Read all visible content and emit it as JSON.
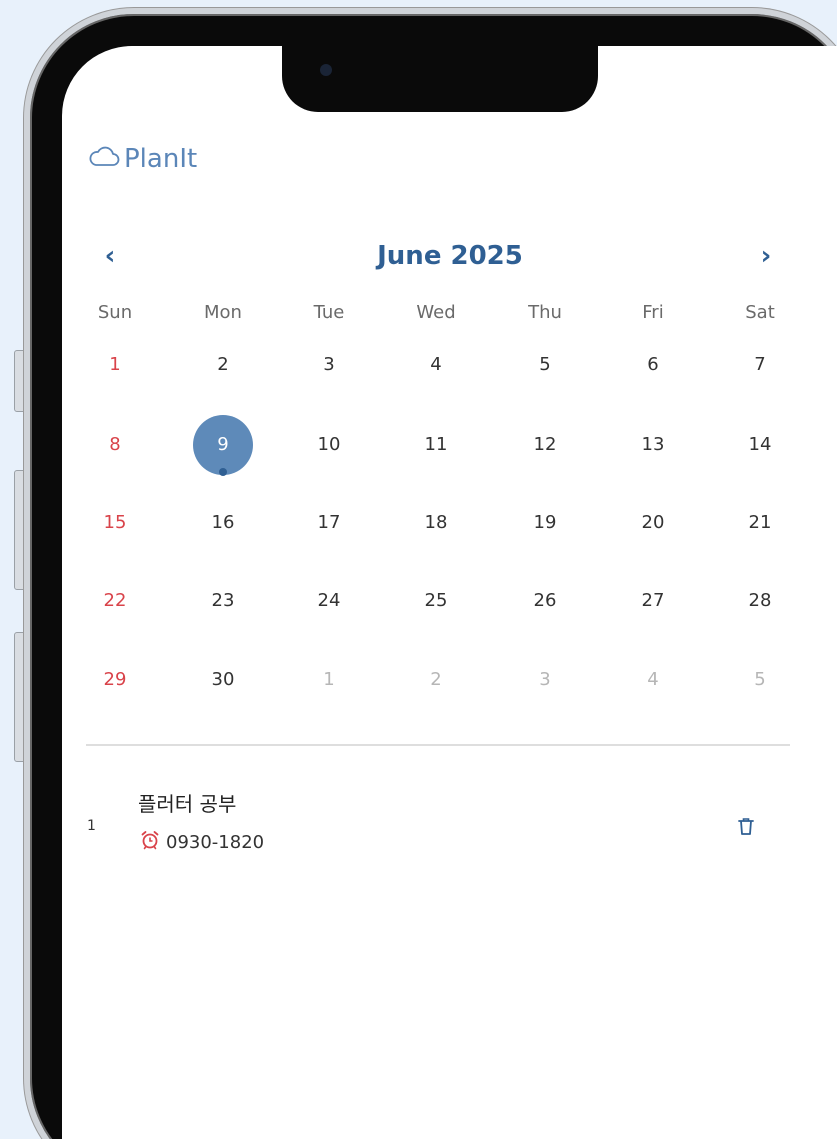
{
  "app": {
    "name": "PlanIt",
    "logo_icon": "cloud-icon",
    "accent_color": "#2f5f93",
    "selected_color": "#5e8ab9",
    "sunday_color": "#d9434a"
  },
  "calendar": {
    "month_title": "June 2025",
    "prev_icon": "chevron-left-icon",
    "next_icon": "chevron-right-icon",
    "prev_label": "‹",
    "next_label": "›",
    "weekdays": [
      "Sun",
      "Mon",
      "Tue",
      "Wed",
      "Thu",
      "Fri",
      "Sat"
    ],
    "selected_day": "9",
    "weeks": [
      [
        {
          "d": "1",
          "t": "sun"
        },
        {
          "d": "2",
          "t": "cur"
        },
        {
          "d": "3",
          "t": "cur"
        },
        {
          "d": "4",
          "t": "cur"
        },
        {
          "d": "5",
          "t": "cur"
        },
        {
          "d": "6",
          "t": "cur"
        },
        {
          "d": "7",
          "t": "cur"
        }
      ],
      [
        {
          "d": "8",
          "t": "sun"
        },
        {
          "d": "9",
          "t": "sel",
          "dot": true
        },
        {
          "d": "10",
          "t": "cur"
        },
        {
          "d": "11",
          "t": "cur"
        },
        {
          "d": "12",
          "t": "cur"
        },
        {
          "d": "13",
          "t": "cur"
        },
        {
          "d": "14",
          "t": "cur"
        }
      ],
      [
        {
          "d": "15",
          "t": "sun"
        },
        {
          "d": "16",
          "t": "cur"
        },
        {
          "d": "17",
          "t": "cur"
        },
        {
          "d": "18",
          "t": "cur"
        },
        {
          "d": "19",
          "t": "cur"
        },
        {
          "d": "20",
          "t": "cur"
        },
        {
          "d": "21",
          "t": "cur"
        }
      ],
      [
        {
          "d": "22",
          "t": "sun"
        },
        {
          "d": "23",
          "t": "cur"
        },
        {
          "d": "24",
          "t": "cur"
        },
        {
          "d": "25",
          "t": "cur"
        },
        {
          "d": "26",
          "t": "cur"
        },
        {
          "d": "27",
          "t": "cur"
        },
        {
          "d": "28",
          "t": "cur"
        }
      ],
      [
        {
          "d": "29",
          "t": "sun"
        },
        {
          "d": "30",
          "t": "cur"
        },
        {
          "d": "1",
          "t": "other"
        },
        {
          "d": "2",
          "t": "other"
        },
        {
          "d": "3",
          "t": "other"
        },
        {
          "d": "4",
          "t": "other"
        },
        {
          "d": "5",
          "t": "other"
        }
      ]
    ]
  },
  "todos": [
    {
      "index": "1",
      "title": "플러터 공부",
      "time": "0930-1820",
      "time_icon": "alarm-clock-icon",
      "delete_icon": "trash-icon"
    }
  ]
}
